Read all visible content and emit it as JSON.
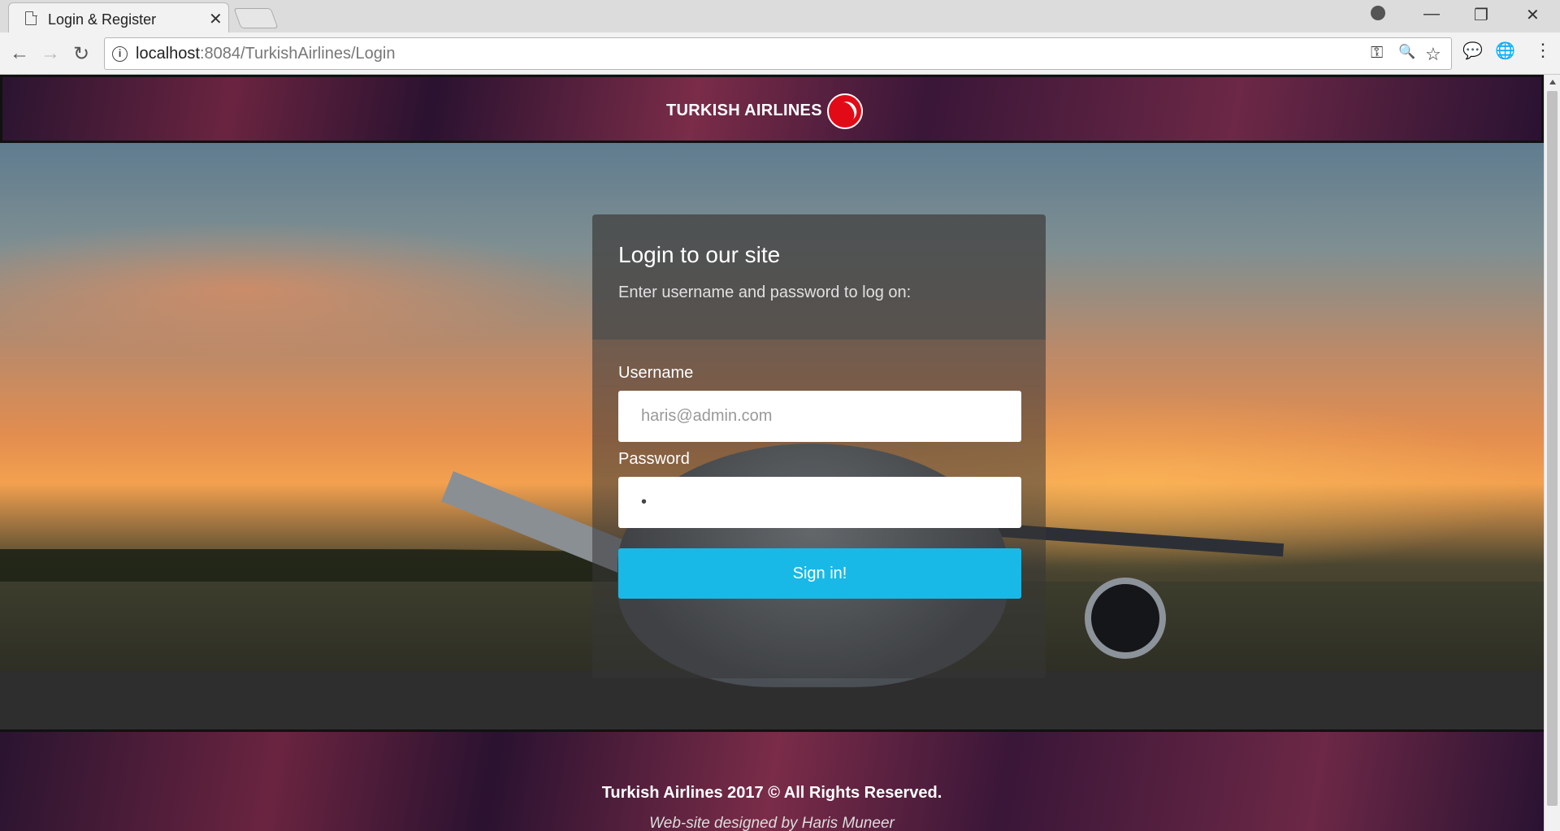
{
  "browser": {
    "tab_title": "Login & Register",
    "tab_close": "✕",
    "url_host": "localhost",
    "url_rest": ":8084/TurkishAirlines/Login",
    "window_controls": {
      "minimize": "—",
      "restore": "❐",
      "close": "✕"
    },
    "nav": {
      "back": "←",
      "forward": "→",
      "reload": "↻"
    },
    "omnibox_icons": {
      "key": "⚿",
      "zoom": "🔍",
      "star": "☆"
    },
    "extensions": {
      "chat": "💬",
      "globe": "🌐",
      "menu": "⋮"
    }
  },
  "header": {
    "logo_text": "TURKISH AIRLINES"
  },
  "login": {
    "title": "Login to our site",
    "subtitle": "Enter username and password to log on:",
    "username_label": "Username",
    "username_placeholder": "haris@admin.com",
    "password_label": "Password",
    "password_value": "•",
    "signin_label": "Sign in!"
  },
  "footer": {
    "copyright": "Turkish Airlines 2017 © All Rights Reserved.",
    "credit": "Web-site designed by Haris Muneer"
  },
  "colors": {
    "accent": "#19b9e7",
    "brand_red": "#e30a17"
  }
}
